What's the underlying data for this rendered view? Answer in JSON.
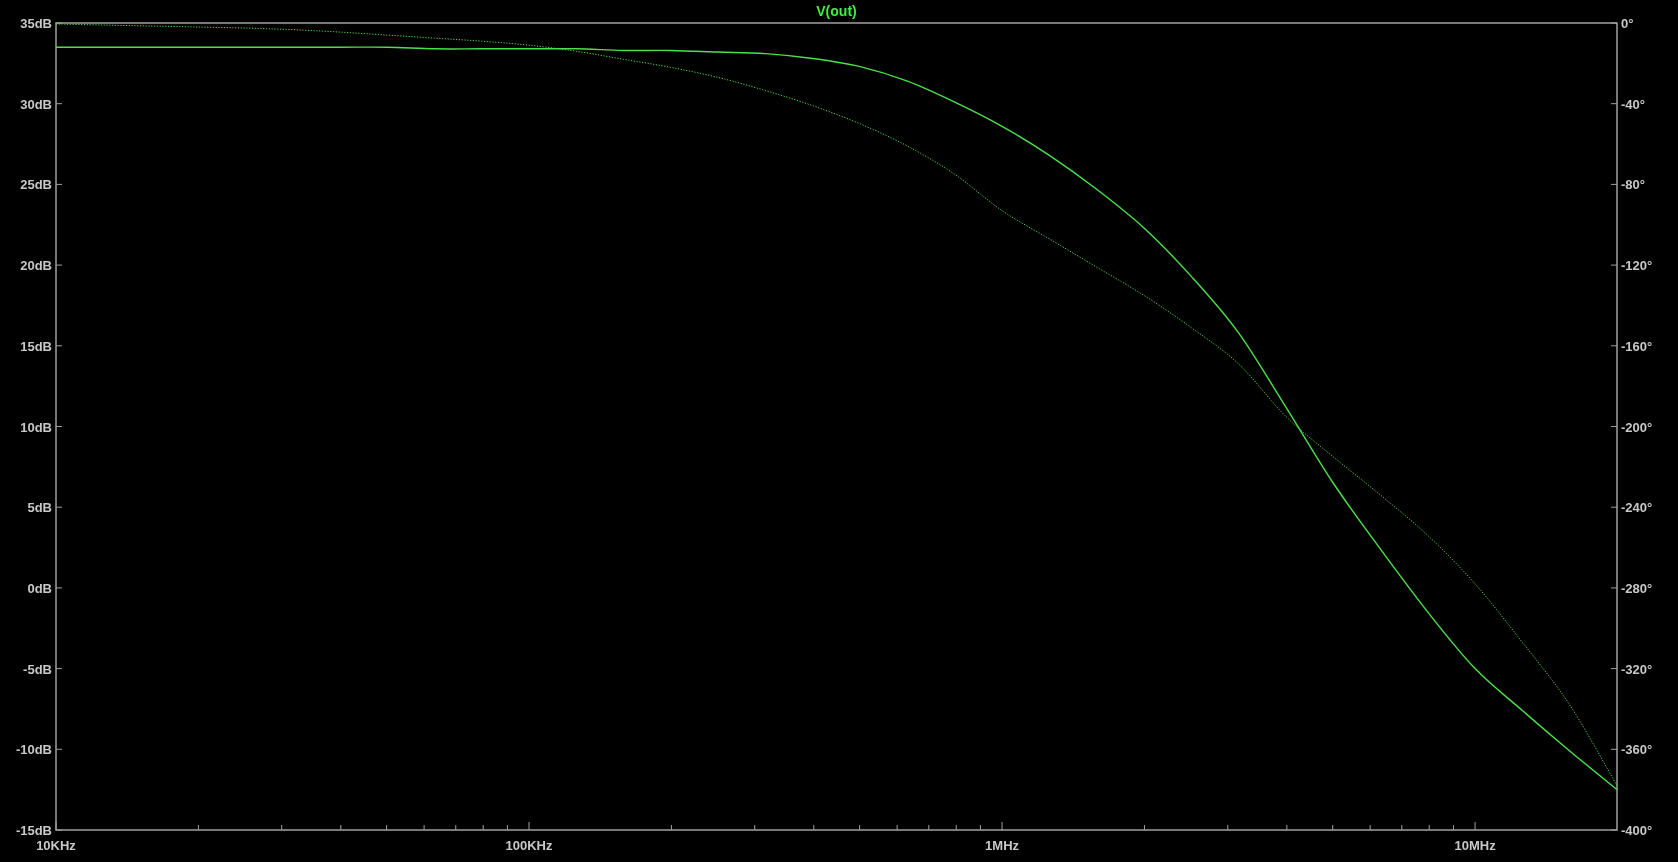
{
  "plot": {
    "chart_data": {
      "type": "line",
      "title": "V(out)",
      "categories": [
        "10KHz",
        null,
        null,
        null,
        null,
        null,
        null,
        null,
        null,
        null,
        "100KHz",
        null,
        null,
        null,
        null,
        null,
        null,
        null,
        null,
        null,
        "1MHz",
        null,
        null,
        null,
        null,
        null,
        null,
        null,
        null,
        null,
        "10MHz",
        null,
        null,
        null
      ],
      "series": [
        {
          "color": "#4ce04c",
          "values": [
            33.5,
            33.5,
            33.5,
            33.5,
            33.5,
            33.5,
            33.5,
            33.5,
            33.4,
            33.4,
            33.4,
            33.4,
            33.3,
            33.3,
            33.2,
            33.1,
            32.8,
            32.3,
            31.4,
            30.1,
            28.6,
            26.8,
            24.7,
            22.3,
            19.3,
            15.8,
            11.2,
            6.5,
            2.4,
            -1.5,
            -5,
            -7.6,
            -10.1,
            -12.5
          ]
        },
        {
          "color": "#4ce04c",
          "axis": "y2",
          "line_style": "dotted",
          "values": [
            -0.5,
            -1,
            -1.5,
            -2,
            -2.5,
            -3.3,
            -4.5,
            -6,
            -7.5,
            -9,
            -11,
            -14,
            -18,
            -22,
            -27,
            -33.5,
            -41,
            -50,
            -61,
            -75,
            -93,
            -107,
            -121,
            -135,
            -151,
            -169,
            -195,
            -215,
            -234,
            -254,
            -278,
            -307,
            -338,
            -378
          ]
        }
      ],
      "ylim": [
        -15,
        35
      ],
      "y2lim": [
        -400,
        0
      ],
      "yticks": [
        {
          "value": 35,
          "label": "35dB"
        },
        {
          "value": 30,
          "label": "30dB"
        },
        {
          "value": 25,
          "label": "25dB"
        },
        {
          "value": 20,
          "label": "20dB"
        },
        {
          "value": 15,
          "label": "15dB"
        },
        {
          "value": 10,
          "label": "10dB"
        },
        {
          "value": 5,
          "label": "5dB"
        },
        {
          "value": 0,
          "label": "0dB"
        },
        {
          "value": -5,
          "label": "-5dB"
        },
        {
          "value": -10,
          "label": "-10dB"
        },
        {
          "value": -15,
          "label": "-15dB"
        }
      ],
      "y2ticks": [
        {
          "value": 0,
          "label": "0°"
        },
        {
          "value": -40,
          "label": "-40°"
        },
        {
          "value": -80,
          "label": "-80°"
        },
        {
          "value": -120,
          "label": "-120°"
        },
        {
          "value": -160,
          "label": "-160°"
        },
        {
          "value": -200,
          "label": "-200°"
        },
        {
          "value": -240,
          "label": "-240°"
        },
        {
          "value": -280,
          "label": "-280°"
        },
        {
          "value": -320,
          "label": "-320°"
        },
        {
          "value": -360,
          "label": "-360°"
        },
        {
          "value": -400,
          "label": "-400°"
        }
      ]
    }
  }
}
